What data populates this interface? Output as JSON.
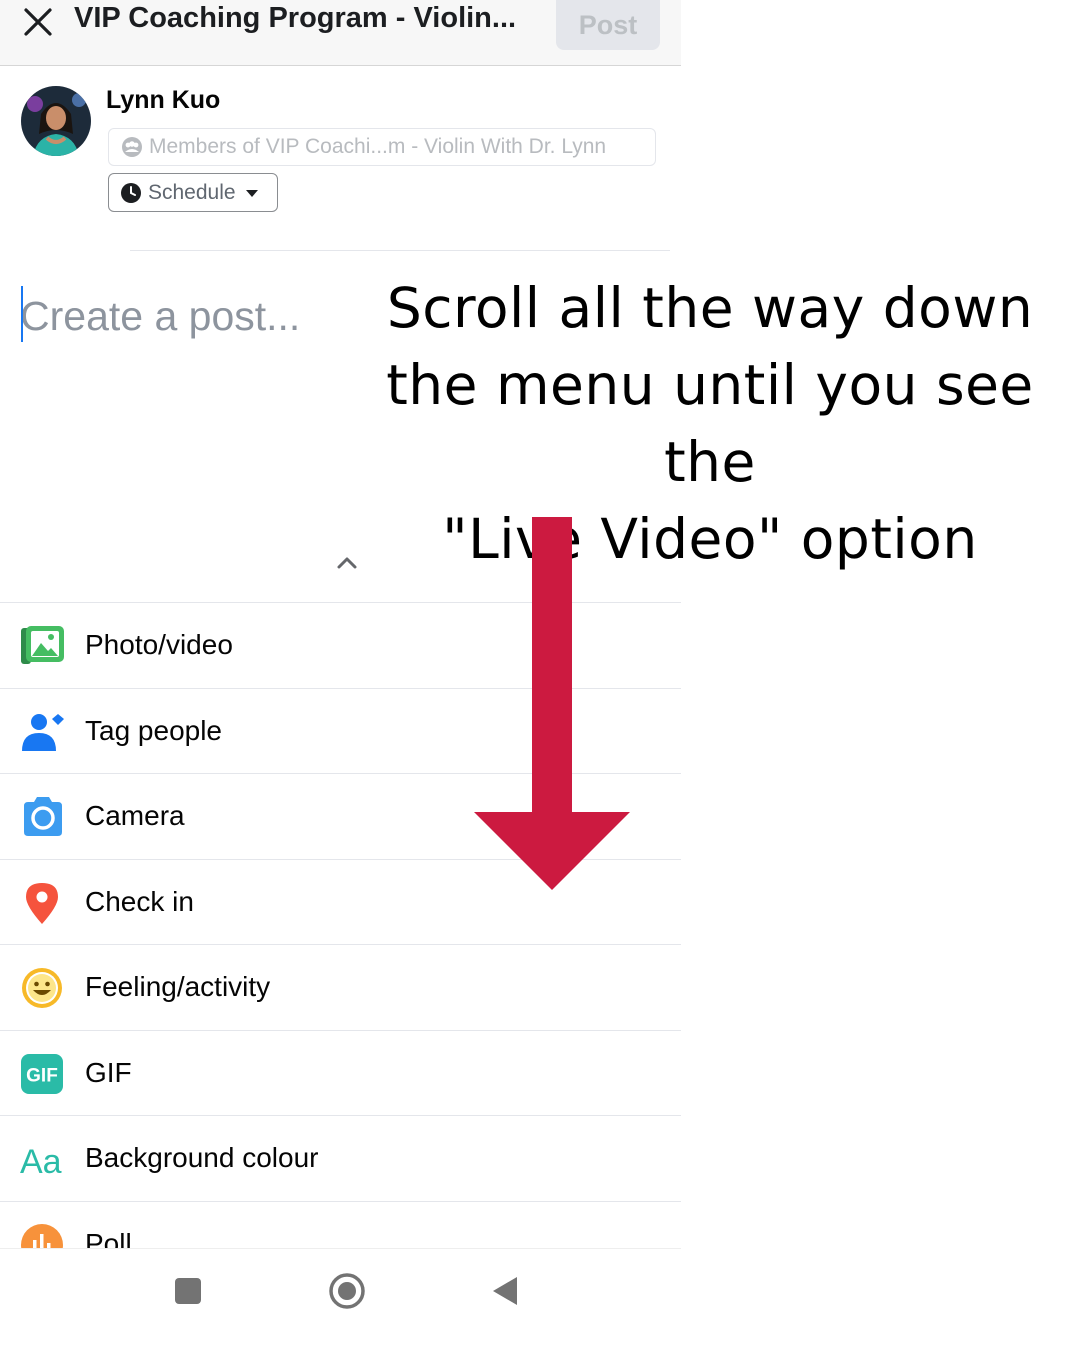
{
  "header": {
    "title": "VIP Coaching Program - Violin...",
    "post_label": "Post"
  },
  "user": {
    "name": "Lynn Kuo",
    "audience": "Members of VIP Coachi...m - Violin With Dr. Lynn",
    "schedule_label": "Schedule"
  },
  "composer": {
    "placeholder": "Create a post..."
  },
  "menu": {
    "items": [
      {
        "label": "Photo/video",
        "icon": "photo-icon"
      },
      {
        "label": "Tag people",
        "icon": "tag-people-icon"
      },
      {
        "label": "Camera",
        "icon": "camera-icon"
      },
      {
        "label": "Check in",
        "icon": "location-pin-icon"
      },
      {
        "label": "Feeling/activity",
        "icon": "smiley-icon"
      },
      {
        "label": "GIF",
        "icon": "gif-icon"
      },
      {
        "label": "Background colour",
        "icon": "text-aa-icon"
      },
      {
        "label": "Poll",
        "icon": "poll-icon"
      }
    ]
  },
  "annotation": {
    "line1": "Scroll all the way down",
    "line2": "the menu until you see the",
    "line3": "\"Live Video\" option",
    "arrow_color": "#cc1a40"
  },
  "colors": {
    "accent": "#1877f2",
    "post_disabled_bg": "#e4e6eb",
    "photo_green": "#45bd62",
    "checkin_red": "#f5533d",
    "feeling_yellow": "#f7b928",
    "gif_teal": "#2abba7",
    "poll_orange": "#f7923b"
  }
}
